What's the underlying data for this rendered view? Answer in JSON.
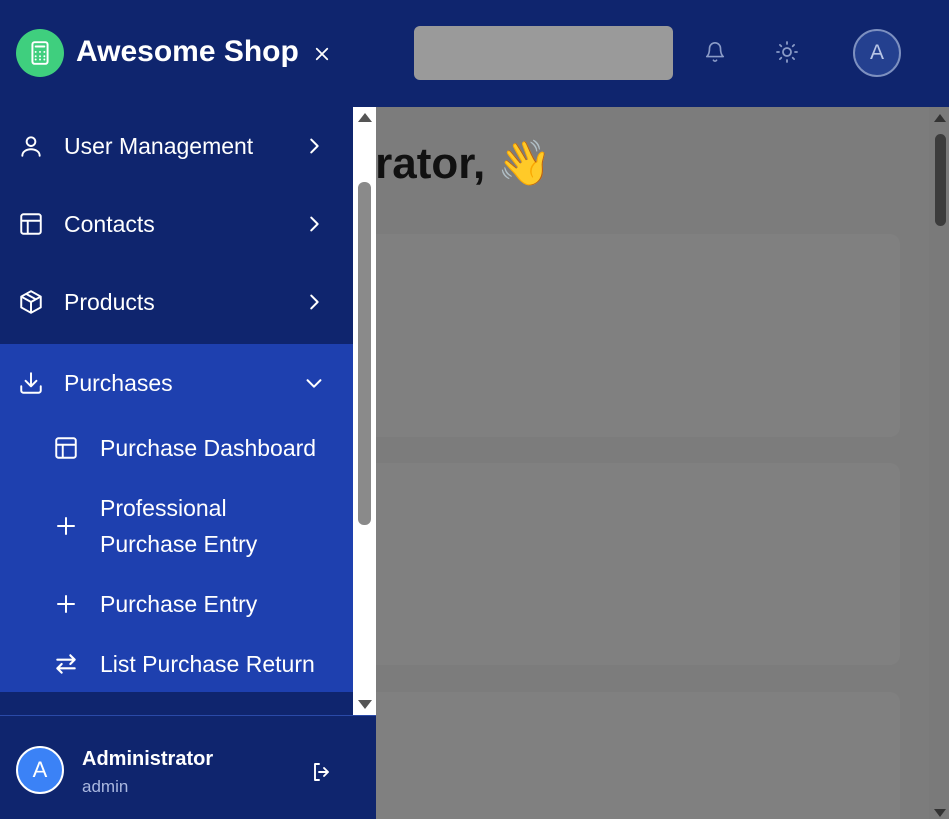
{
  "brand": {
    "name": "Awesome Shop",
    "color": "#3fcf7e"
  },
  "colors": {
    "sidebar": "#0f256e",
    "active_group": "#1e40af",
    "overlay": "#7c7c7c"
  },
  "header": {
    "avatar_initial": "A"
  },
  "main": {
    "greeting": "strator, 👋"
  },
  "menu": [
    {
      "label": "User Management",
      "icon": "user-icon",
      "expanded": false
    },
    {
      "label": "Contacts",
      "icon": "layout-icon",
      "expanded": false
    },
    {
      "label": "Products",
      "icon": "package-icon",
      "expanded": false
    },
    {
      "label": "Purchases",
      "icon": "download-icon",
      "expanded": true,
      "children": [
        {
          "label": "Purchase Dashboard",
          "icon": "layout-icon"
        },
        {
          "label": "Professional Purchase Entry",
          "icon": "plus-icon"
        },
        {
          "label": "Purchase Entry",
          "icon": "plus-icon"
        },
        {
          "label": "List Purchase Return",
          "icon": "swap-icon"
        }
      ]
    }
  ],
  "user": {
    "initial": "A",
    "name": "Administrator",
    "role": "admin"
  }
}
